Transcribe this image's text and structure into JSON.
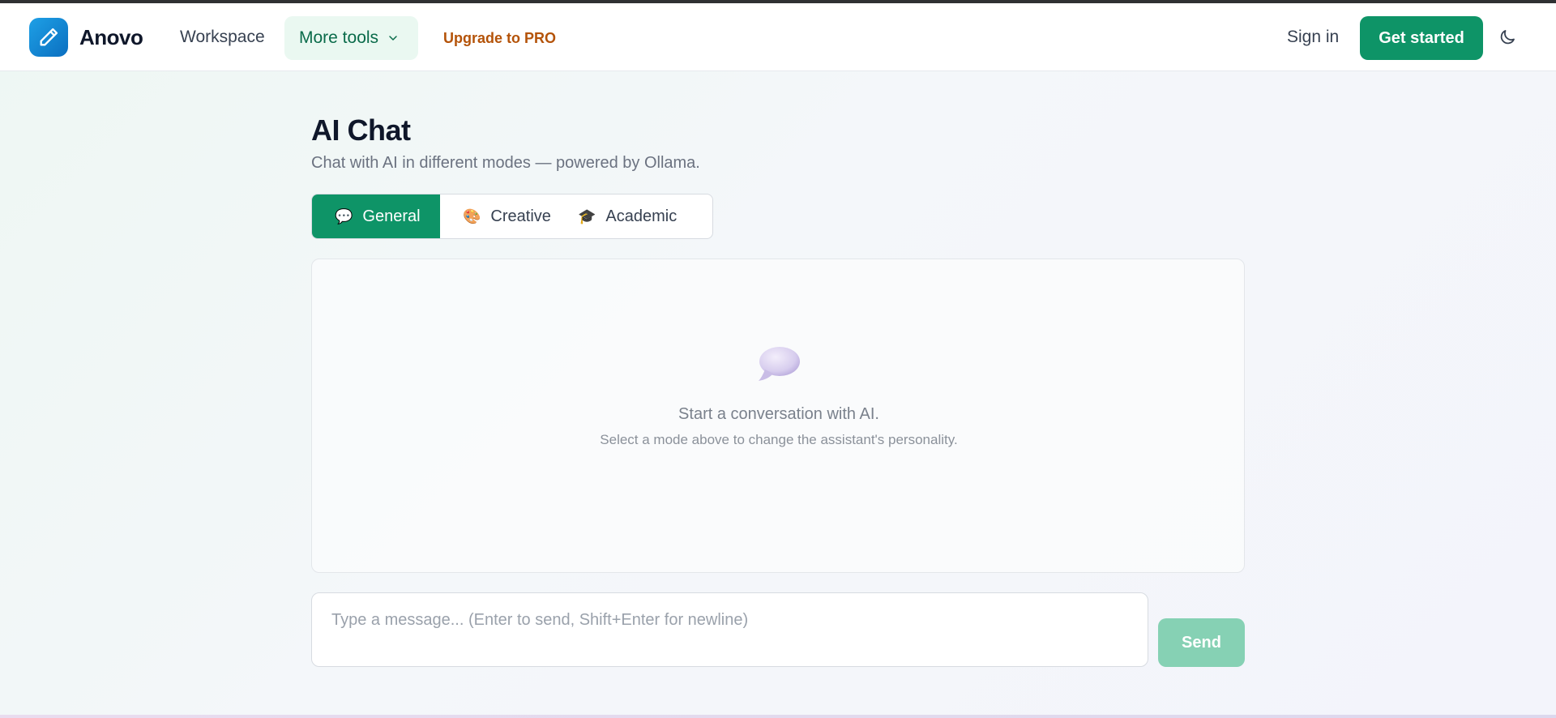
{
  "brand": {
    "name": "Anovo"
  },
  "nav": {
    "workspace": "Workspace",
    "more_tools": "More tools",
    "upgrade": "Upgrade to PRO",
    "sign_in": "Sign in",
    "get_started": "Get started"
  },
  "page": {
    "title": "AI Chat",
    "subtitle": "Chat with AI in different modes — powered by Ollama."
  },
  "modes": [
    {
      "emoji": "💬",
      "label": "General",
      "active": true
    },
    {
      "emoji": "🎨",
      "label": "Creative",
      "active": false
    },
    {
      "emoji": "🎓",
      "label": "Academic",
      "active": false
    }
  ],
  "chat": {
    "empty_title": "Start a conversation with AI.",
    "empty_hint": "Select a mode above to change the assistant's personality."
  },
  "composer": {
    "value": "",
    "placeholder": "Type a message... (Enter to send, Shift+Enter for newline)",
    "send_label": "Send"
  },
  "colors": {
    "accent": "#0e9467",
    "accent_light": "#86d1b4",
    "upgrade": "#b45309",
    "logo": "#1ea0e6"
  },
  "icons": {
    "logo": "pencil-icon",
    "more_tools": "chevron-down-icon",
    "theme": "moon-icon",
    "empty_state": "speech-bubble-icon"
  }
}
